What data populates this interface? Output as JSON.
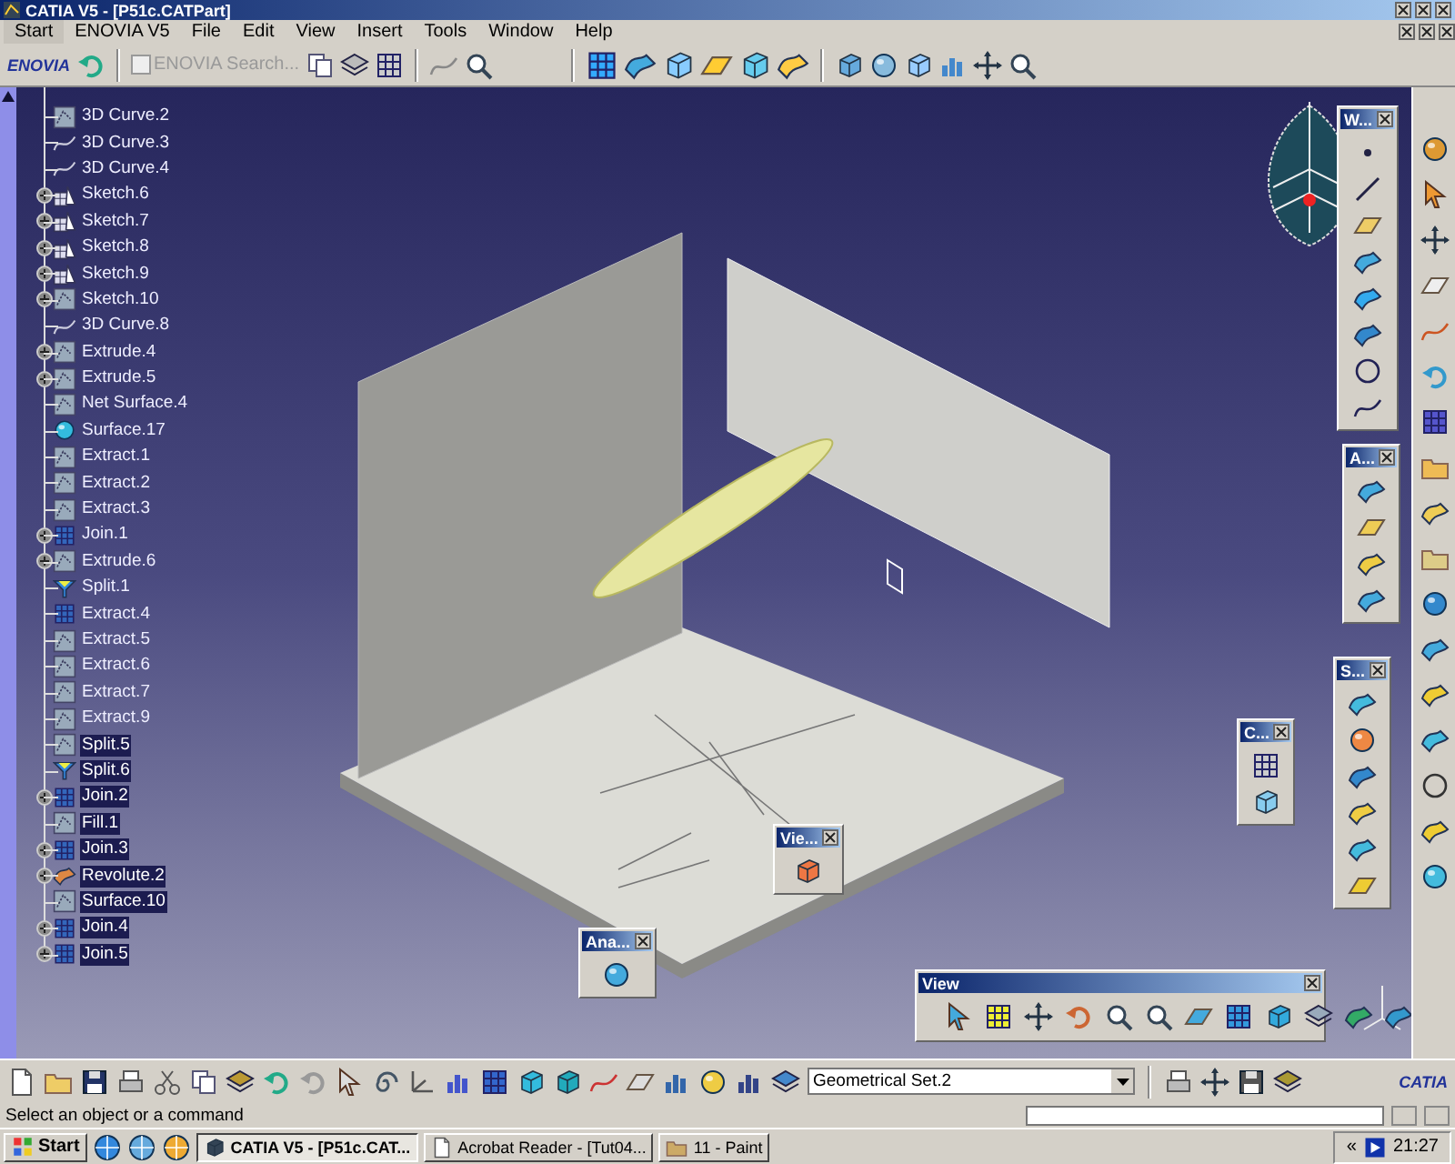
{
  "window": {
    "title": "CATIA V5 - [P51c.CATPart]"
  },
  "menu": [
    {
      "label": "Start",
      "selected": true
    },
    {
      "label": "ENOVIA V5",
      "selected": false
    },
    {
      "label": "File",
      "selected": false
    },
    {
      "label": "Edit",
      "selected": false
    },
    {
      "label": "View",
      "selected": false
    },
    {
      "label": "Insert",
      "selected": false
    },
    {
      "label": "Tools",
      "selected": false
    },
    {
      "label": "Window",
      "selected": false
    },
    {
      "label": "Help",
      "selected": false
    }
  ],
  "top_toolbar": {
    "logo": "ENOVIA",
    "search": {
      "label": "ENOVIA Search...",
      "checked": false,
      "disabled": true
    }
  },
  "tree": {
    "items": [
      {
        "label": "3D Curve.2",
        "kind": "patch",
        "expandable": false,
        "selected": false
      },
      {
        "label": "3D Curve.3",
        "kind": "curve",
        "expandable": false,
        "selected": false
      },
      {
        "label": "3D Curve.4",
        "kind": "curve",
        "expandable": false,
        "selected": false
      },
      {
        "label": "Sketch.6",
        "kind": "sketch",
        "expandable": true,
        "selected": false
      },
      {
        "label": "Sketch.7",
        "kind": "sketch",
        "expandable": true,
        "selected": false
      },
      {
        "label": "Sketch.8",
        "kind": "sketch",
        "expandable": true,
        "selected": false
      },
      {
        "label": "Sketch.9",
        "kind": "sketch",
        "expandable": true,
        "selected": false
      },
      {
        "label": "Sketch.10",
        "kind": "patch",
        "expandable": true,
        "selected": false
      },
      {
        "label": "3D Curve.8",
        "kind": "curve",
        "expandable": false,
        "selected": false
      },
      {
        "label": "Extrude.4",
        "kind": "patch",
        "expandable": true,
        "selected": false
      },
      {
        "label": "Extrude.5",
        "kind": "patch",
        "expandable": true,
        "selected": false
      },
      {
        "label": "Net Surface.4",
        "kind": "patch",
        "expandable": false,
        "selected": false
      },
      {
        "label": "Surface.17",
        "kind": "sphere",
        "expandable": false,
        "selected": false
      },
      {
        "label": "Extract.1",
        "kind": "patch",
        "expandable": false,
        "selected": false
      },
      {
        "label": "Extract.2",
        "kind": "patch",
        "expandable": false,
        "selected": false
      },
      {
        "label": "Extract.3",
        "kind": "patch",
        "expandable": false,
        "selected": false
      },
      {
        "label": "Join.1",
        "kind": "join",
        "expandable": true,
        "selected": false
      },
      {
        "label": "Extrude.6",
        "kind": "patch",
        "expandable": true,
        "selected": false
      },
      {
        "label": "Split.1",
        "kind": "split",
        "expandable": false,
        "selected": false
      },
      {
        "label": "Extract.4",
        "kind": "join",
        "expandable": false,
        "selected": false
      },
      {
        "label": "Extract.5",
        "kind": "patch",
        "expandable": false,
        "selected": false
      },
      {
        "label": "Extract.6",
        "kind": "patch",
        "expandable": false,
        "selected": false
      },
      {
        "label": "Extract.7",
        "kind": "patch",
        "expandable": false,
        "selected": false
      },
      {
        "label": "Extract.9",
        "kind": "patch",
        "expandable": false,
        "selected": false
      },
      {
        "label": "Split.5",
        "kind": "patch",
        "expandable": false,
        "selected": true
      },
      {
        "label": "Split.6",
        "kind": "split",
        "expandable": false,
        "selected": true
      },
      {
        "label": "Join.2",
        "kind": "join",
        "expandable": true,
        "selected": true
      },
      {
        "label": "Fill.1",
        "kind": "patch",
        "expandable": false,
        "selected": true
      },
      {
        "label": "Join.3",
        "kind": "join",
        "expandable": true,
        "selected": true
      },
      {
        "label": "Revolute.2",
        "kind": "revolute",
        "expandable": true,
        "selected": true
      },
      {
        "label": "Surface.10",
        "kind": "patch",
        "expandable": false,
        "selected": true
      },
      {
        "label": "Join.4",
        "kind": "join",
        "expandable": true,
        "selected": true
      },
      {
        "label": "Join.5",
        "kind": "join",
        "expandable": true,
        "selected": true
      }
    ]
  },
  "floating_toolbars": [
    {
      "title": "W...",
      "kind": "vertical"
    },
    {
      "title": "A...",
      "kind": "vertical"
    },
    {
      "title": "S...",
      "kind": "vertical"
    },
    {
      "title": "C...",
      "kind": "vertical"
    },
    {
      "title": "Vie...",
      "kind": "vertical"
    },
    {
      "title": "Ana...",
      "kind": "vertical"
    },
    {
      "title": "View",
      "kind": "horizontal"
    }
  ],
  "bottom_toolbar": {
    "dropdown": "Geometrical Set.2",
    "logo": "CATIA"
  },
  "status_bar": {
    "message": "Select an object or a command"
  },
  "taskbar": {
    "start": "Start",
    "tasks": [
      {
        "label": "CATIA V5 - [P51c.CAT...",
        "selected": true
      },
      {
        "label": "Acrobat Reader - [Tut04...",
        "selected": false
      },
      {
        "label": "11 - Paint",
        "selected": false
      }
    ],
    "tray": "«",
    "clock": "21:27"
  }
}
